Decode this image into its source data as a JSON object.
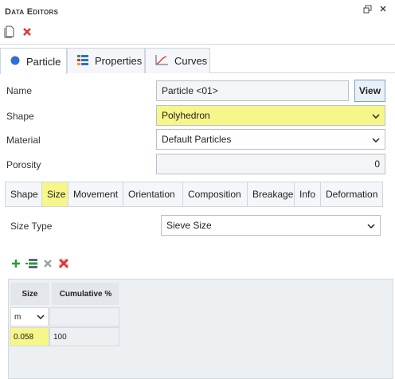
{
  "panel": {
    "title": "Data Editors",
    "restore_icon": "restore-window-icon",
    "close_icon": "close-icon"
  },
  "toolbar": {
    "new_icon": "new-document-icon",
    "delete_icon": "delete-icon"
  },
  "main_tabs": [
    {
      "label": "Particle",
      "icon": "circle-icon",
      "active": true
    },
    {
      "label": "Properties",
      "icon": "properties-icon",
      "active": false
    },
    {
      "label": "Curves",
      "icon": "curve-icon",
      "active": false
    }
  ],
  "form": {
    "name_label": "Name",
    "name_value": "Particle <01>",
    "view_button": "View",
    "shape_label": "Shape",
    "shape_value": "Polyhedron",
    "material_label": "Material",
    "material_value": "Default Particles",
    "porosity_label": "Porosity",
    "porosity_value": "0"
  },
  "sub_tabs": [
    {
      "label": "Shape",
      "active": false
    },
    {
      "label": "Size",
      "active": true
    },
    {
      "label": "Movement",
      "active": false
    },
    {
      "label": "Orientation",
      "active": false
    },
    {
      "label": "Composition",
      "active": false
    },
    {
      "label": "Breakage",
      "active": false
    },
    {
      "label": "Info",
      "active": false
    },
    {
      "label": "Deformation",
      "active": false
    }
  ],
  "size": {
    "size_type_label": "Size Type",
    "size_type_value": "Sieve Size",
    "grid": {
      "headers": [
        "Size",
        "Cumulative %"
      ],
      "unit": "m",
      "rows": [
        [
          "0.058",
          "100"
        ]
      ]
    }
  },
  "colors": {
    "highlight": "#f6f68a",
    "accent_blue": "#2f6fd3",
    "add_green": "#2e9a3a",
    "delete_red": "#e03030"
  }
}
